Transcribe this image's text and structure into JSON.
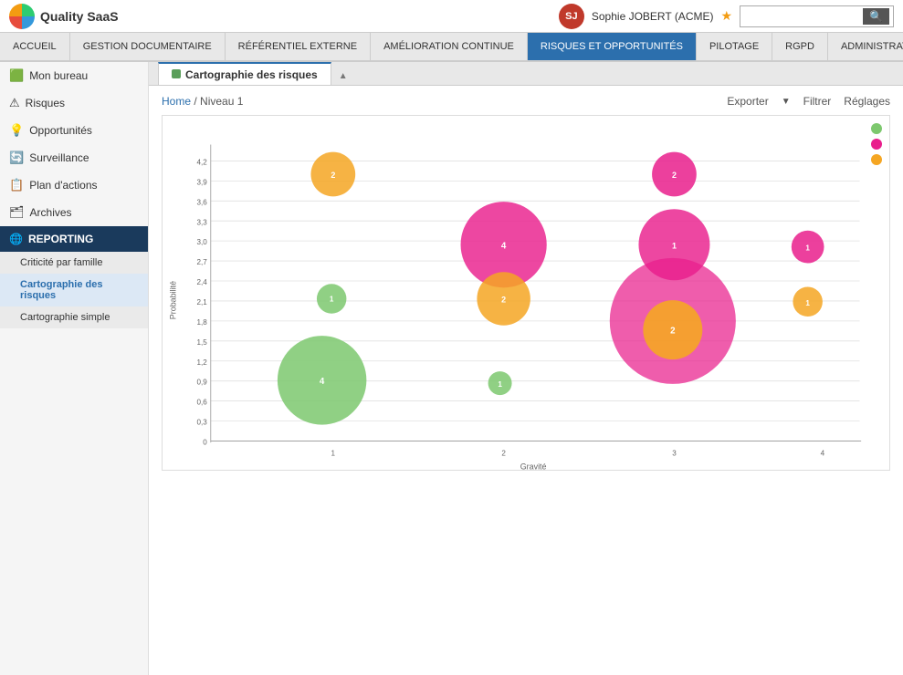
{
  "app": {
    "logo_text": "Quality SaaS",
    "user_name": "Sophie JOBERT (ACME)",
    "search_placeholder": ""
  },
  "navbar": {
    "items": [
      {
        "label": "ACCUEIL",
        "active": false
      },
      {
        "label": "GESTION DOCUMENTAIRE",
        "active": false
      },
      {
        "label": "RÉFÉRENTIEL EXTERNE",
        "active": false
      },
      {
        "label": "AMÉLIORATION CONTINUE",
        "active": false
      },
      {
        "label": "RISQUES ET OPPORTUNITÉS",
        "active": true
      },
      {
        "label": "PILOTAGE",
        "active": false
      },
      {
        "label": "RGPD",
        "active": false
      },
      {
        "label": "ADMINISTRATION",
        "active": false
      }
    ]
  },
  "sidebar": {
    "items": [
      {
        "label": "Mon bureau",
        "icon": "🟩",
        "type": "item"
      },
      {
        "label": "Risques",
        "icon": "⚠️",
        "type": "item"
      },
      {
        "label": "Opportunités",
        "icon": "💡",
        "type": "item"
      },
      {
        "label": "Surveillance",
        "icon": "🔄",
        "type": "item"
      },
      {
        "label": "Plan d'actions",
        "icon": "📋",
        "type": "item"
      },
      {
        "label": "Archives",
        "icon": "📁",
        "type": "item"
      }
    ],
    "reporting": {
      "label": "REPORTING",
      "sub_items": [
        {
          "label": "Criticité par famille",
          "active": false
        },
        {
          "label": "Cartographie des risques",
          "active": true
        },
        {
          "label": "Cartographie simple",
          "active": false
        }
      ]
    }
  },
  "tabs": [
    {
      "label": "Cartographie des risques",
      "active": true
    }
  ],
  "breadcrumb": {
    "home": "Home",
    "separator": "/",
    "level": "Niveau 1"
  },
  "toolbar": {
    "export_label": "Exporter",
    "filter_label": "Filtrer",
    "settings_label": "Réglages"
  },
  "chart": {
    "x_axis_label": "Gravité",
    "y_axis_label": "Probabilité",
    "y_ticks": [
      "0",
      "0,3",
      "0,6",
      "0,9",
      "1,2",
      "1,5",
      "1,8",
      "2,1",
      "2,4",
      "2,7",
      "3,0",
      "3,3",
      "3,6",
      "3,9",
      "4,2"
    ],
    "x_ticks": [
      "1",
      "2",
      "3",
      "4"
    ],
    "legend": [
      {
        "color": "#4caf50",
        "label": "Vert"
      },
      {
        "color": "#e91e8c",
        "label": "Rose"
      },
      {
        "color": "#f5a623",
        "label": "Orange"
      }
    ],
    "bubbles": [
      {
        "cx": 240,
        "cy": 155,
        "r": 32,
        "color": "#f5a623",
        "label": "2",
        "opacity": 0.85
      },
      {
        "cx": 430,
        "cy": 220,
        "r": 62,
        "color": "#e91e8c",
        "label": "4",
        "opacity": 0.85
      },
      {
        "cx": 640,
        "cy": 155,
        "r": 32,
        "color": "#e91e8c",
        "label": "2",
        "opacity": 0.85
      },
      {
        "cx": 430,
        "cy": 305,
        "r": 38,
        "color": "#f5a623",
        "label": "2",
        "opacity": 0.85
      },
      {
        "cx": 240,
        "cy": 310,
        "r": 22,
        "color": "#4caf50",
        "label": "1",
        "opacity": 0.85
      },
      {
        "cx": 640,
        "cy": 240,
        "r": 52,
        "color": "#e91e8c",
        "label": "1",
        "opacity": 0.85
      },
      {
        "cx": 620,
        "cy": 295,
        "r": 90,
        "color": "#e91e8c",
        "label": "2",
        "opacity": 0.75
      },
      {
        "cx": 620,
        "cy": 295,
        "r": 42,
        "color": "#f5a623",
        "label": "2",
        "opacity": 0.9
      },
      {
        "cx": 820,
        "cy": 245,
        "r": 24,
        "color": "#e91e8c",
        "label": "1",
        "opacity": 0.85
      },
      {
        "cx": 820,
        "cy": 315,
        "r": 22,
        "color": "#f5a623",
        "label": "1",
        "opacity": 0.85
      },
      {
        "cx": 200,
        "cy": 395,
        "r": 65,
        "color": "#4caf50",
        "label": "4",
        "opacity": 0.85
      },
      {
        "cx": 430,
        "cy": 400,
        "r": 18,
        "color": "#4caf50",
        "label": "1",
        "opacity": 0.85
      }
    ]
  }
}
